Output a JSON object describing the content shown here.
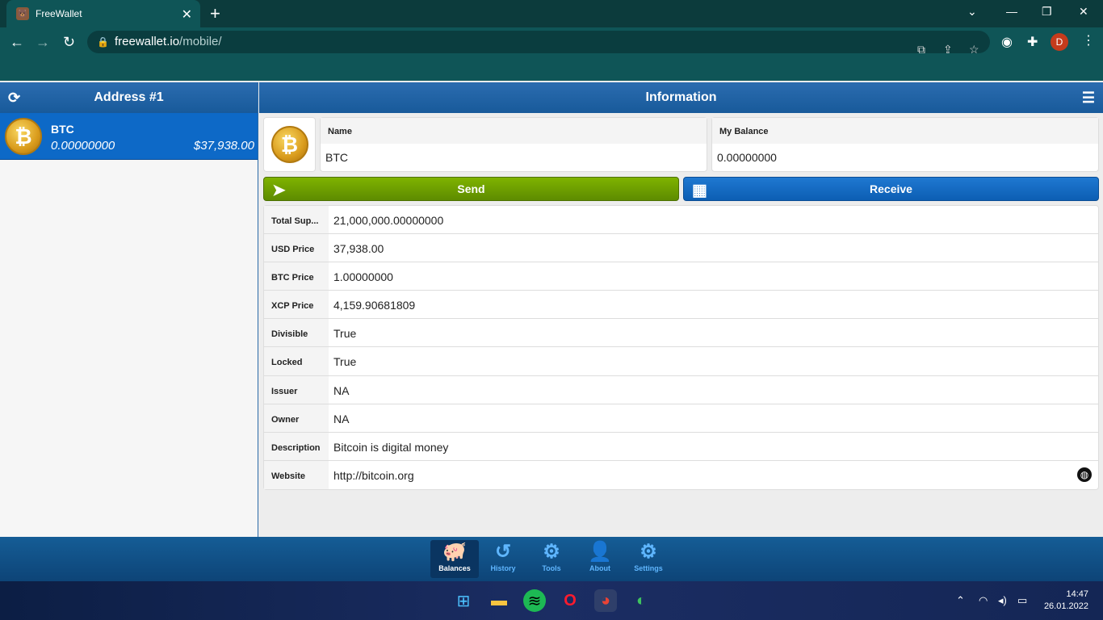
{
  "browser": {
    "tab_title": "FreeWallet",
    "url_host": "freewallet.io",
    "url_path": "/mobile/",
    "profile_initial": "D"
  },
  "left_panel": {
    "title": "Address #1",
    "asset": {
      "name": "BTC",
      "quantity": "0.00000000",
      "usd_value": "$37,938.00"
    }
  },
  "right_panel": {
    "title": "Information",
    "name_label": "Name",
    "name_value": "BTC",
    "balance_label": "My Balance",
    "balance_value": "0.00000000",
    "send_label": "Send",
    "receive_label": "Receive",
    "rows": [
      {
        "key": "Total Sup...",
        "value": "21,000,000.00000000"
      },
      {
        "key": "USD Price",
        "value": "37,938.00"
      },
      {
        "key": "BTC Price",
        "value": "1.00000000"
      },
      {
        "key": "XCP Price",
        "value": "4,159.90681809"
      },
      {
        "key": "Divisible",
        "value": "True"
      },
      {
        "key": "Locked",
        "value": "True"
      },
      {
        "key": "Issuer",
        "value": "NA"
      },
      {
        "key": "Owner",
        "value": "NA"
      },
      {
        "key": "Description",
        "value": "Bitcoin is digital money"
      },
      {
        "key": "Website",
        "value": "http://bitcoin.org"
      }
    ]
  },
  "bottom_nav": [
    {
      "label": "Balances",
      "icon": "piggy-bank-icon",
      "active": true
    },
    {
      "label": "History",
      "icon": "history-icon",
      "active": false
    },
    {
      "label": "Tools",
      "icon": "gears-icon",
      "active": false
    },
    {
      "label": "About",
      "icon": "user-icon",
      "active": false
    },
    {
      "label": "Settings",
      "icon": "gear-icon",
      "active": false
    }
  ],
  "taskbar": {
    "time": "14:47",
    "date": "26.01.2022"
  },
  "colors": {
    "header_blue": "#185a9a",
    "selected_row": "#0d69c7",
    "send_green": "#6f9f00",
    "receive_blue": "#1068c4",
    "browser_teal": "#0f5557"
  }
}
